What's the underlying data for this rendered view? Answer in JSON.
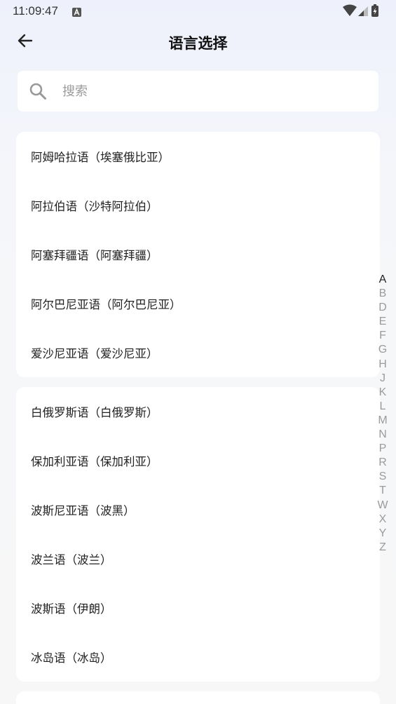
{
  "status_bar": {
    "time": "11:09:47",
    "icons": [
      "text-a-icon",
      "wifi-icon",
      "signal-icon",
      "battery-charging-icon"
    ]
  },
  "header": {
    "title": "语言选择",
    "back_icon": "arrow-left-icon"
  },
  "search": {
    "placeholder": "搜索",
    "value": "",
    "icon": "search-icon"
  },
  "groups": [
    {
      "items": [
        "阿姆哈拉语（埃塞俄比亚）",
        "阿拉伯语（沙特阿拉伯）",
        "阿塞拜疆语（阿塞拜疆）",
        "阿尔巴尼亚语（阿尔巴尼亚）",
        "爱沙尼亚语（爱沙尼亚）"
      ]
    },
    {
      "items": [
        "白俄罗斯语（白俄罗斯）",
        "保加利亚语（保加利亚）",
        "波斯尼亚语（波黑）",
        "波兰语（波兰）",
        "波斯语（伊朗）",
        "冰岛语（冰岛）"
      ]
    }
  ],
  "alphabet_index": {
    "active": "A",
    "letters": [
      "A",
      "B",
      "D",
      "E",
      "F",
      "G",
      "H",
      "J",
      "K",
      "L",
      "M",
      "N",
      "P",
      "R",
      "S",
      "T",
      "W",
      "X",
      "Y",
      "Z"
    ]
  }
}
